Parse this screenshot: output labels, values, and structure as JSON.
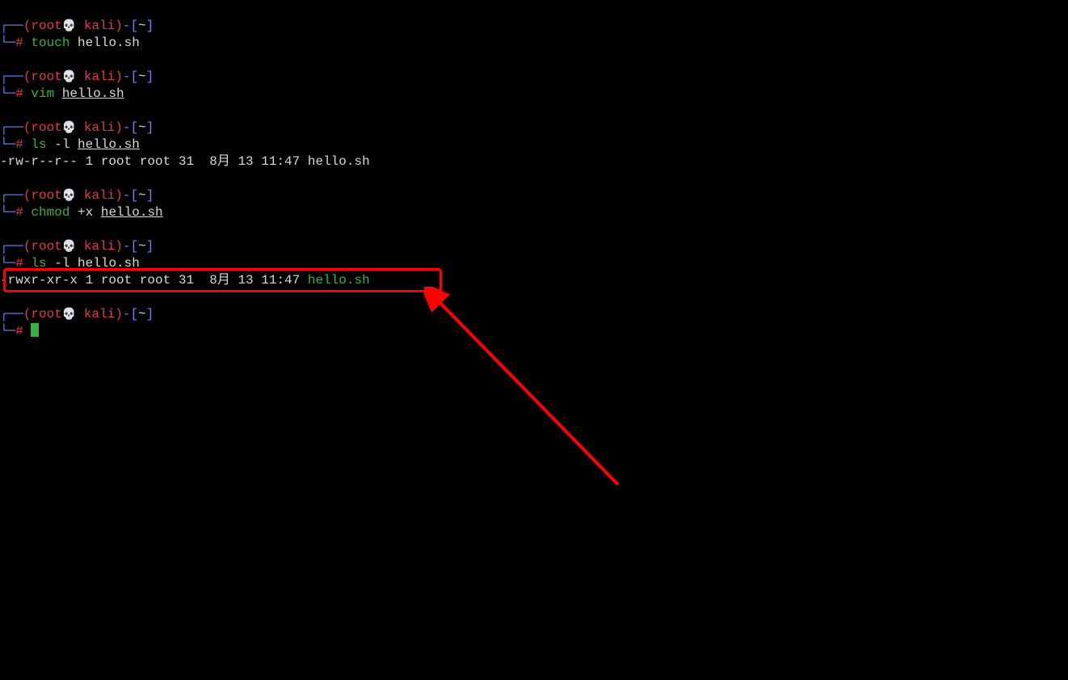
{
  "prompts": [
    {
      "user": "root",
      "host": "kali",
      "cwd": "~",
      "cmd_green": "touch",
      "cmd_rest": "hello.sh",
      "underlined": false
    },
    {
      "user": "root",
      "host": "kali",
      "cwd": "~",
      "cmd_green": "vim",
      "cmd_rest": "hello.sh",
      "underlined": true
    },
    {
      "user": "root",
      "host": "kali",
      "cwd": "~",
      "cmd_green": "ls",
      "cmd_mid": "-l",
      "cmd_rest": "hello.sh",
      "underlined": true,
      "output": "-rw-r--r-- 1 root root 31  8月 13 11:47 hello.sh"
    },
    {
      "user": "root",
      "host": "kali",
      "cwd": "~",
      "cmd_green": "chmod",
      "cmd_mid": "+x",
      "cmd_rest": "hello.sh",
      "underlined": true
    },
    {
      "user": "root",
      "host": "kali",
      "cwd": "~",
      "cmd_green": "ls",
      "cmd_mid": "-l",
      "cmd_rest": "hello.sh",
      "output_pre": "-rwxr-xr-x 1 root root 31  8月 13 11:47 ",
      "output_exec": "hello.sh"
    },
    {
      "user": "root",
      "host": "kali",
      "cwd": "~",
      "cursor": true
    }
  ],
  "skull": "💀",
  "symbols": {
    "box_top_left": "┌──",
    "box_mid": "├",
    "box_vert": "│",
    "box_bottom": "└─",
    "paren_open": "(",
    "paren_close": ")",
    "brace_open": "{",
    "brace_close": "}",
    "dash": "-",
    "bracket_open": "[",
    "bracket_close": "]",
    "hash": "# "
  }
}
